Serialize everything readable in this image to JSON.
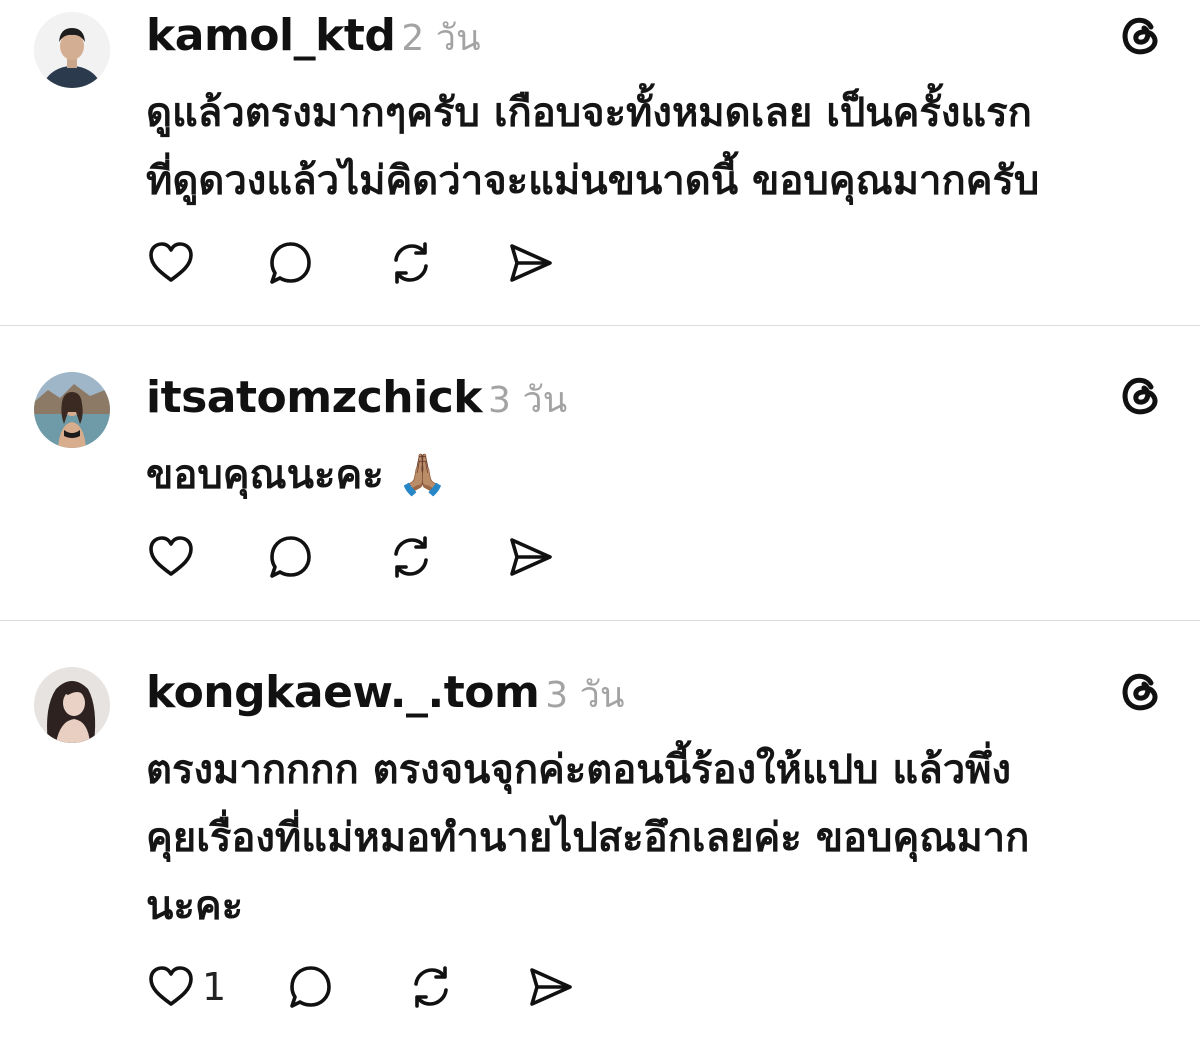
{
  "posts": [
    {
      "username": "kamol_ktd",
      "timestamp": "2 วัน",
      "text": "ดูแล้วตรงมากๆครับ เกือบจะทั้งหมดเลย เป็นครั้งแรก\nที่ดูดวงแล้วไม่คิดว่าจะแม่นขนาดนี้ ขอบคุณมากครับ",
      "like_count": ""
    },
    {
      "username": "itsatomzchick",
      "timestamp": "3 วัน",
      "text": "ขอบคุณนะคะ 🙏🏽",
      "like_count": ""
    },
    {
      "username": "kongkaew._.tom",
      "timestamp": "3 วัน",
      "text": "ตรงมากกกก ตรงจนจุกค่ะตอนนี้ร้องให้แปบ แล้วพึ่ง\nคุยเรื่องที่แม่หมอทำนายไปสะอึกเลยค่ะ ขอบคุณมาก\nนะคะ",
      "like_count": "1"
    }
  ],
  "icons": {
    "like": "heart-icon",
    "reply": "comment-icon",
    "repost": "repost-icon",
    "share": "send-icon",
    "brand": "threads-icon"
  },
  "colors": {
    "text": "#111111",
    "timestamp": "#a3a3a3",
    "divider": "#dcdcdc"
  }
}
